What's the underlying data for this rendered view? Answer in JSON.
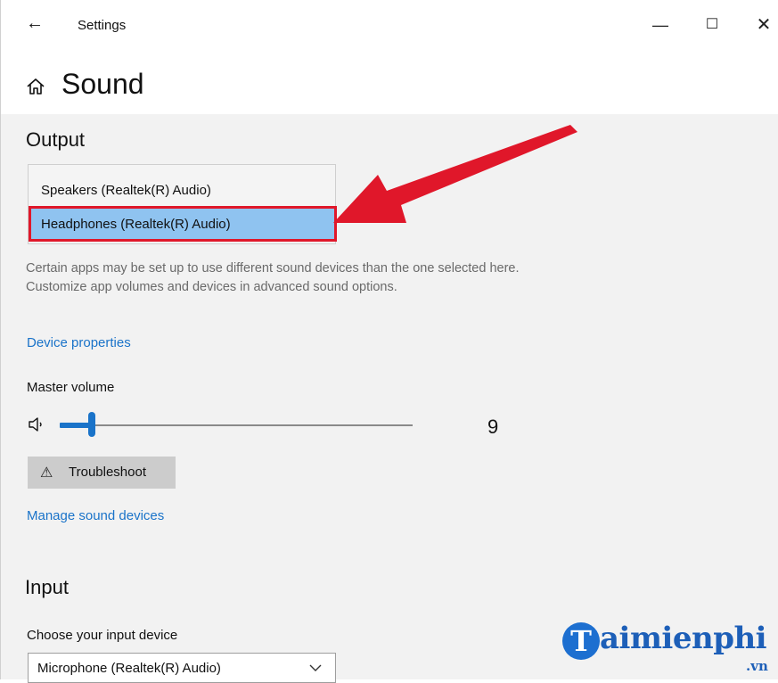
{
  "window": {
    "title": "Settings",
    "back_glyph": "←",
    "minimize_glyph": "—",
    "maximize_glyph": "☐",
    "close_glyph": "✕"
  },
  "page": {
    "title": "Sound",
    "icon": "home-icon"
  },
  "output": {
    "section_title": "Output",
    "devices": [
      "Speakers (Realtek(R) Audio)",
      "Headphones (Realtek(R) Audio)"
    ],
    "selected_device": "Headphones (Realtek(R) Audio)",
    "highlight_color": "#e0172a",
    "description": "Certain apps may be set up to use different sound devices than the one selected here. Customize app volumes and devices in advanced sound options.",
    "device_properties_link": "Device properties",
    "master_volume_label": "Master volume",
    "volume_value": "9",
    "volume_fraction": 0.09,
    "troubleshoot_label": "Troubleshoot",
    "troubleshoot_icon": "warning-icon",
    "manage_link": "Manage sound devices"
  },
  "input": {
    "section_title": "Input",
    "choose_label": "Choose your input device",
    "selected_device": "Microphone (Realtek(R) Audio)"
  },
  "watermark": {
    "letter": "T",
    "text": "aimienphi",
    "suffix": ".vn"
  },
  "colors": {
    "accent": "#1a73c9",
    "selection": "#8fc3f0",
    "annotation_red": "#e0172a",
    "content_bg": "#f2f2f2"
  }
}
